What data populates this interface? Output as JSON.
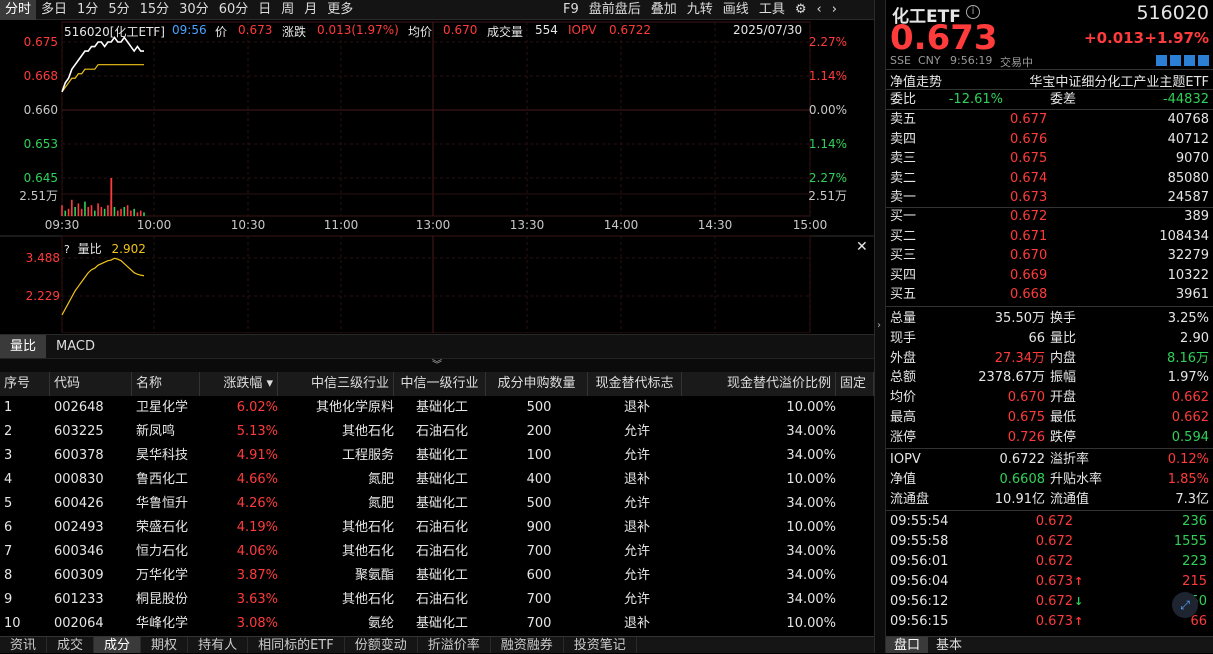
{
  "toolbar": {
    "periods": [
      "分时",
      "多日",
      "1分",
      "5分",
      "15分",
      "30分",
      "60分",
      "日",
      "周",
      "月",
      "更多"
    ],
    "active": "分时",
    "tools": [
      "F9",
      "盘前盘后",
      "叠加",
      "九转",
      "画线",
      "工具"
    ]
  },
  "chart_header": {
    "code_name": "516020[化工ETF]",
    "time": "09:56",
    "price_label": "价",
    "price": "0.673",
    "change_label": "涨跌",
    "change": "0.013(1.97%)",
    "avg_label": "均价",
    "avg": "0.670",
    "volume_label": "成交量",
    "volume": "554",
    "iopv_label": "IOPV",
    "iopv": "0.6722",
    "date": "2025/07/30"
  },
  "price_axis_left": [
    "0.675",
    "0.668",
    "0.660",
    "0.653",
    "0.645",
    "2.51万"
  ],
  "price_axis_right": [
    "2.27%",
    "1.14%",
    "0.00%",
    "1.14%",
    "2.27%",
    "2.51万"
  ],
  "time_axis": [
    "09:30",
    "10:00",
    "10:30",
    "11:00",
    "13:00",
    "13:30",
    "14:00",
    "14:30",
    "15:00"
  ],
  "ratio_panel": {
    "label": "量比",
    "value": "2.902",
    "axis": [
      "3.488",
      "2.229"
    ]
  },
  "chart_data": {
    "type": "line",
    "series": [
      {
        "name": "价",
        "values": [
          0.664,
          0.666,
          0.667,
          0.669,
          0.67,
          0.671,
          0.672,
          0.673,
          0.673,
          0.674,
          0.674,
          0.675,
          0.675,
          0.674,
          0.675,
          0.675,
          0.676,
          0.675,
          0.675,
          0.676,
          0.675,
          0.674,
          0.673,
          0.674,
          0.673,
          0.673
        ]
      },
      {
        "name": "均价",
        "values": [
          0.664,
          0.665,
          0.666,
          0.667,
          0.667,
          0.668,
          0.668,
          0.669,
          0.669,
          0.669,
          0.669,
          0.67,
          0.67,
          0.67,
          0.67,
          0.67,
          0.67,
          0.67,
          0.67,
          0.67,
          0.67,
          0.67,
          0.67,
          0.67,
          0.67,
          0.67
        ]
      },
      {
        "name": "量比",
        "values": [
          1.6,
          1.8,
          2.0,
          2.2,
          2.4,
          2.55,
          2.7,
          2.85,
          3.0,
          3.1,
          3.15,
          3.25,
          3.3,
          3.35,
          3.4,
          3.42,
          3.48,
          3.45,
          3.4,
          3.3,
          3.2,
          3.1,
          3.0,
          2.95,
          2.92,
          2.9
        ]
      }
    ],
    "volume_max": 25100,
    "ylim_price": [
      0.645,
      0.675
    ]
  },
  "subtabs": [
    "量比",
    "MACD"
  ],
  "subtab_active": "量比",
  "table": {
    "headers": [
      "序号",
      "代码",
      "名称",
      "涨跌幅",
      "中信三级行业",
      "中信一级行业",
      "成分申购数量",
      "现金替代标志",
      "现金替代溢价比例",
      "固定"
    ],
    "rows": [
      [
        "1",
        "002648",
        "卫星化学",
        "6.02%",
        "其他化学原料",
        "基础化工",
        "500",
        "退补",
        "10.00%"
      ],
      [
        "2",
        "603225",
        "新凤鸣",
        "5.13%",
        "其他石化",
        "石油石化",
        "200",
        "允许",
        "34.00%"
      ],
      [
        "3",
        "600378",
        "昊华科技",
        "4.91%",
        "工程服务",
        "基础化工",
        "100",
        "允许",
        "34.00%"
      ],
      [
        "4",
        "000830",
        "鲁西化工",
        "4.66%",
        "氮肥",
        "基础化工",
        "400",
        "退补",
        "10.00%"
      ],
      [
        "5",
        "600426",
        "华鲁恒升",
        "4.26%",
        "氮肥",
        "基础化工",
        "500",
        "允许",
        "34.00%"
      ],
      [
        "6",
        "002493",
        "荣盛石化",
        "4.19%",
        "其他石化",
        "石油石化",
        "900",
        "退补",
        "10.00%"
      ],
      [
        "7",
        "600346",
        "恒力石化",
        "4.06%",
        "其他石化",
        "石油石化",
        "700",
        "允许",
        "34.00%"
      ],
      [
        "8",
        "600309",
        "万华化学",
        "3.87%",
        "聚氨酯",
        "基础化工",
        "600",
        "允许",
        "34.00%"
      ],
      [
        "9",
        "601233",
        "桐昆股份",
        "3.63%",
        "其他石化",
        "石油石化",
        "700",
        "允许",
        "34.00%"
      ],
      [
        "10",
        "002064",
        "华峰化学",
        "3.08%",
        "氨纶",
        "基础化工",
        "700",
        "退补",
        "10.00%"
      ]
    ]
  },
  "bottom_tabs": [
    "资讯",
    "成交",
    "成分",
    "期权",
    "持有人",
    "相同标的ETF",
    "份额变动",
    "折溢价率",
    "融资融券",
    "投资笔记"
  ],
  "bottom_active": "成分",
  "quote": {
    "name": "化工ETF",
    "code": "516020",
    "price": "0.673",
    "change": "+0.013",
    "change_pct": "+1.97%",
    "exchange": "SSE",
    "currency": "CNY",
    "time": "9:56:19",
    "status": "交易中",
    "nav_label": "净值走势",
    "full_name": "华宝中证细分化工产业主题ETF"
  },
  "weibi": {
    "label": "委比",
    "value": "-12.61%",
    "diff_label": "委差",
    "diff": "-44832"
  },
  "asks": [
    {
      "label": "卖五",
      "price": "0.677",
      "vol": "40768"
    },
    {
      "label": "卖四",
      "price": "0.676",
      "vol": "40712"
    },
    {
      "label": "卖三",
      "price": "0.675",
      "vol": "9070"
    },
    {
      "label": "卖二",
      "price": "0.674",
      "vol": "85080"
    },
    {
      "label": "卖一",
      "price": "0.673",
      "vol": "24587"
    }
  ],
  "bids": [
    {
      "label": "买一",
      "price": "0.672",
      "vol": "389"
    },
    {
      "label": "买二",
      "price": "0.671",
      "vol": "108434"
    },
    {
      "label": "买三",
      "price": "0.670",
      "vol": "32279"
    },
    {
      "label": "买四",
      "price": "0.669",
      "vol": "10322"
    },
    {
      "label": "买五",
      "price": "0.668",
      "vol": "3961"
    }
  ],
  "stats": [
    {
      "l1": "总量",
      "v1": "35.50万",
      "c1": "white",
      "l2": "换手",
      "v2": "3.25%",
      "c2": "white"
    },
    {
      "l1": "现手",
      "v1": "66",
      "c1": "white",
      "l2": "量比",
      "v2": "2.90",
      "c2": "white"
    },
    {
      "l1": "外盘",
      "v1": "27.34万",
      "c1": "red",
      "l2": "内盘",
      "v2": "8.16万",
      "c2": "green"
    },
    {
      "l1": "总额",
      "v1": "2378.67万",
      "c1": "white",
      "l2": "振幅",
      "v2": "1.97%",
      "c2": "white"
    },
    {
      "l1": "均价",
      "v1": "0.670",
      "c1": "red",
      "l2": "开盘",
      "v2": "0.662",
      "c2": "red"
    },
    {
      "l1": "最高",
      "v1": "0.675",
      "c1": "red",
      "l2": "最低",
      "v2": "0.662",
      "c2": "red"
    },
    {
      "l1": "涨停",
      "v1": "0.726",
      "c1": "red",
      "l2": "跌停",
      "v2": "0.594",
      "c2": "green"
    }
  ],
  "stats2": [
    {
      "l1": "IOPV",
      "v1": "0.6722",
      "c1": "white",
      "l2": "溢折率",
      "v2": "0.12%",
      "c2": "red"
    },
    {
      "l1": "净值",
      "v1": "0.6608",
      "c1": "green",
      "l2": "升贴水率",
      "v2": "1.85%",
      "c2": "red"
    },
    {
      "l1": "流通盘",
      "v1": "10.91亿",
      "c1": "white",
      "l2": "流通值",
      "v2": "7.3亿",
      "c2": "white"
    }
  ],
  "ticks": [
    {
      "time": "09:55:54",
      "price": "0.672",
      "arrow": "",
      "vol": "236",
      "vc": "green"
    },
    {
      "time": "09:55:58",
      "price": "0.672",
      "arrow": "",
      "vol": "1555",
      "vc": "green"
    },
    {
      "time": "09:56:01",
      "price": "0.672",
      "arrow": "",
      "vol": "223",
      "vc": "green"
    },
    {
      "time": "09:56:04",
      "price": "0.673",
      "arrow": "↑",
      "ac": "red",
      "vol": "215",
      "vc": "red"
    },
    {
      "time": "09:56:12",
      "price": "0.672",
      "arrow": "↓",
      "ac": "green",
      "vol": "50",
      "vc": "green"
    },
    {
      "time": "09:56:15",
      "price": "0.673",
      "arrow": "↑",
      "ac": "red",
      "vol": "66",
      "vc": "red"
    }
  ],
  "right_tabs": [
    "盘口",
    "基本"
  ],
  "right_active": "盘口"
}
